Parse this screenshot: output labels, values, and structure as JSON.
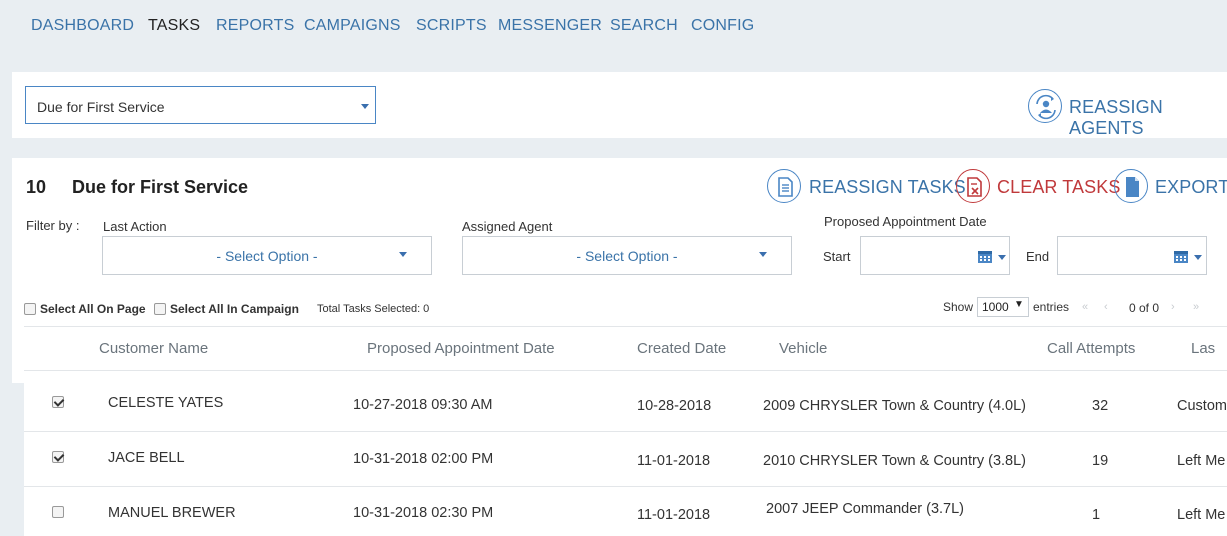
{
  "nav": {
    "items": [
      {
        "label": "DASHBOARD"
      },
      {
        "label": "TASKS"
      },
      {
        "label": "REPORTS"
      },
      {
        "label": "CAMPAIGNS"
      },
      {
        "label": "SCRIPTS"
      },
      {
        "label": "MESSENGER"
      },
      {
        "label": "SEARCH"
      },
      {
        "label": "CONFIG"
      }
    ],
    "active": "TASKS"
  },
  "campaign_select": {
    "value": "Due for First Service"
  },
  "reassign_agents": {
    "label": "REASSIGN AGENTS"
  },
  "header": {
    "count": "10",
    "title": "Due for First Service"
  },
  "actions": {
    "reassign_tasks": "REASSIGN TASKS",
    "clear_tasks": "CLEAR TASKS",
    "export": "EXPORT"
  },
  "filters": {
    "filter_by": "Filter by :",
    "last_action": {
      "label": "Last Action",
      "value": "- Select Option -"
    },
    "assigned_agent": {
      "label": "Assigned Agent",
      "value": "- Select Option -"
    },
    "proposed_date": {
      "label": "Proposed Appointment Date",
      "start_label": "Start",
      "end_label": "End"
    }
  },
  "selection": {
    "select_all_page": "Select All On Page",
    "select_all_campaign": "Select All In Campaign",
    "total_selected": "Total Tasks Selected: 0"
  },
  "paging": {
    "show": "Show",
    "page_size": "1000",
    "entries": "entries",
    "range": "0 of 0",
    "first": "«",
    "prev": "‹",
    "next": "›",
    "last": "»"
  },
  "table": {
    "columns": [
      "Customer Name",
      "Proposed Appointment Date",
      "Created Date",
      "Vehicle",
      "Call Attempts",
      "Las"
    ],
    "rows": [
      {
        "checked": true,
        "name": "CELESTE YATES",
        "proposed": "10-27-2018 09:30 AM",
        "created": "10-28-2018",
        "vehicle": "2009 CHRYSLER Town & Country (4.0L)",
        "attempts": "32",
        "last": "Custom"
      },
      {
        "checked": true,
        "name": "JACE BELL",
        "proposed": "10-31-2018 02:00 PM",
        "created": "11-01-2018",
        "vehicle": "2010 CHRYSLER Town & Country (3.8L)",
        "attempts": "19",
        "last": "Left Me"
      },
      {
        "checked": false,
        "name": "MANUEL BREWER",
        "proposed": "10-31-2018 02:30 PM",
        "created": "11-01-2018",
        "vehicle": "2007 JEEP Commander (3.7L)",
        "attempts": "1",
        "last": "Left Me"
      }
    ]
  },
  "colors": {
    "accent": "#3a73a8",
    "danger": "#c0393b",
    "background": "#e9eef2"
  }
}
